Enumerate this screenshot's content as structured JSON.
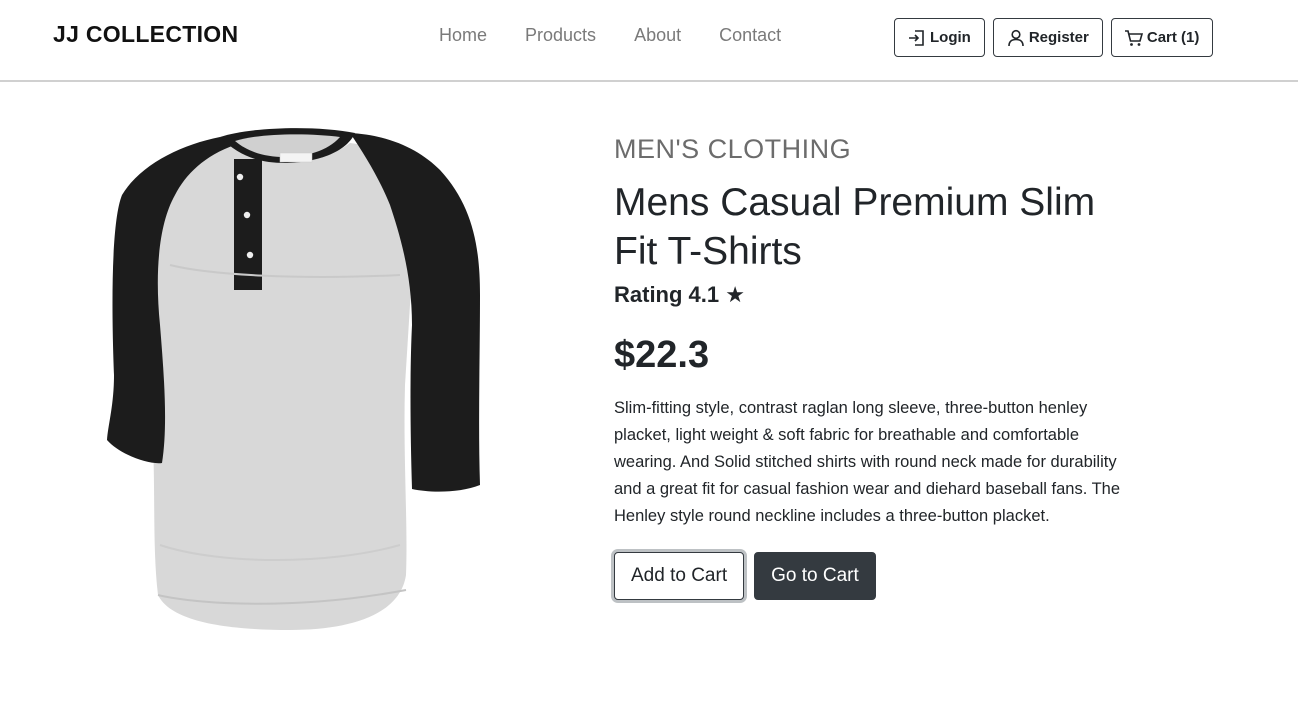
{
  "navbar": {
    "brand": "JJ COLLECTION",
    "links": [
      "Home",
      "Products",
      "About",
      "Contact"
    ],
    "buttons": {
      "login": "Login",
      "register": "Register",
      "cart": "Cart (1)"
    }
  },
  "product": {
    "image_alt": "black and grey raglan henley t-shirt",
    "category": "MEN'S CLOTHING",
    "title": "Mens Casual Premium Slim Fit T-Shirts",
    "rating": "Rating 4.1 ★",
    "price": "$22.3",
    "description": "Slim-fitting style, contrast raglan long sleeve, three-button henley placket, light weight & soft fabric for breathable and comfortable wearing. And Solid stitched shirts with round neck made for durability and a great fit for casual fashion wear and diehard baseball fans. The Henley style round neckline includes a three-button placket.",
    "add_to_cart_label": "Add to Cart",
    "go_to_cart_label": "Go to Cart"
  },
  "colors": {
    "dark": "#343a40",
    "sleeve": "#1c1c1c",
    "body_fabric": "#d9d9d9",
    "nav_link": "#7a7a7a"
  },
  "icons": [
    "login-icon",
    "person-icon",
    "cart-icon"
  ]
}
